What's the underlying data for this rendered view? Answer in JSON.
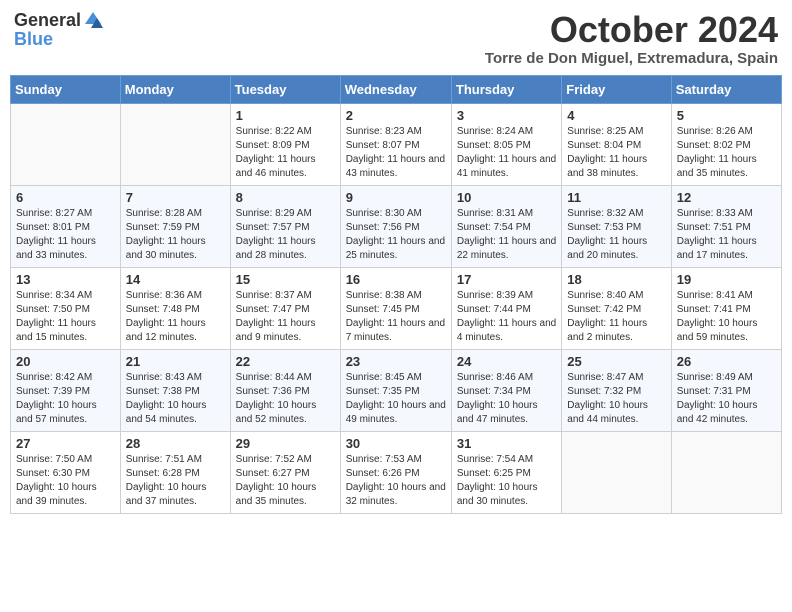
{
  "header": {
    "logo_general": "General",
    "logo_blue": "Blue",
    "month": "October 2024",
    "location": "Torre de Don Miguel, Extremadura, Spain"
  },
  "days_of_week": [
    "Sunday",
    "Monday",
    "Tuesday",
    "Wednesday",
    "Thursday",
    "Friday",
    "Saturday"
  ],
  "weeks": [
    [
      {
        "day": "",
        "sunrise": "",
        "sunset": "",
        "daylight": ""
      },
      {
        "day": "",
        "sunrise": "",
        "sunset": "",
        "daylight": ""
      },
      {
        "day": "1",
        "sunrise": "Sunrise: 8:22 AM",
        "sunset": "Sunset: 8:09 PM",
        "daylight": "Daylight: 11 hours and 46 minutes."
      },
      {
        "day": "2",
        "sunrise": "Sunrise: 8:23 AM",
        "sunset": "Sunset: 8:07 PM",
        "daylight": "Daylight: 11 hours and 43 minutes."
      },
      {
        "day": "3",
        "sunrise": "Sunrise: 8:24 AM",
        "sunset": "Sunset: 8:05 PM",
        "daylight": "Daylight: 11 hours and 41 minutes."
      },
      {
        "day": "4",
        "sunrise": "Sunrise: 8:25 AM",
        "sunset": "Sunset: 8:04 PM",
        "daylight": "Daylight: 11 hours and 38 minutes."
      },
      {
        "day": "5",
        "sunrise": "Sunrise: 8:26 AM",
        "sunset": "Sunset: 8:02 PM",
        "daylight": "Daylight: 11 hours and 35 minutes."
      }
    ],
    [
      {
        "day": "6",
        "sunrise": "Sunrise: 8:27 AM",
        "sunset": "Sunset: 8:01 PM",
        "daylight": "Daylight: 11 hours and 33 minutes."
      },
      {
        "day": "7",
        "sunrise": "Sunrise: 8:28 AM",
        "sunset": "Sunset: 7:59 PM",
        "daylight": "Daylight: 11 hours and 30 minutes."
      },
      {
        "day": "8",
        "sunrise": "Sunrise: 8:29 AM",
        "sunset": "Sunset: 7:57 PM",
        "daylight": "Daylight: 11 hours and 28 minutes."
      },
      {
        "day": "9",
        "sunrise": "Sunrise: 8:30 AM",
        "sunset": "Sunset: 7:56 PM",
        "daylight": "Daylight: 11 hours and 25 minutes."
      },
      {
        "day": "10",
        "sunrise": "Sunrise: 8:31 AM",
        "sunset": "Sunset: 7:54 PM",
        "daylight": "Daylight: 11 hours and 22 minutes."
      },
      {
        "day": "11",
        "sunrise": "Sunrise: 8:32 AM",
        "sunset": "Sunset: 7:53 PM",
        "daylight": "Daylight: 11 hours and 20 minutes."
      },
      {
        "day": "12",
        "sunrise": "Sunrise: 8:33 AM",
        "sunset": "Sunset: 7:51 PM",
        "daylight": "Daylight: 11 hours and 17 minutes."
      }
    ],
    [
      {
        "day": "13",
        "sunrise": "Sunrise: 8:34 AM",
        "sunset": "Sunset: 7:50 PM",
        "daylight": "Daylight: 11 hours and 15 minutes."
      },
      {
        "day": "14",
        "sunrise": "Sunrise: 8:36 AM",
        "sunset": "Sunset: 7:48 PM",
        "daylight": "Daylight: 11 hours and 12 minutes."
      },
      {
        "day": "15",
        "sunrise": "Sunrise: 8:37 AM",
        "sunset": "Sunset: 7:47 PM",
        "daylight": "Daylight: 11 hours and 9 minutes."
      },
      {
        "day": "16",
        "sunrise": "Sunrise: 8:38 AM",
        "sunset": "Sunset: 7:45 PM",
        "daylight": "Daylight: 11 hours and 7 minutes."
      },
      {
        "day": "17",
        "sunrise": "Sunrise: 8:39 AM",
        "sunset": "Sunset: 7:44 PM",
        "daylight": "Daylight: 11 hours and 4 minutes."
      },
      {
        "day": "18",
        "sunrise": "Sunrise: 8:40 AM",
        "sunset": "Sunset: 7:42 PM",
        "daylight": "Daylight: 11 hours and 2 minutes."
      },
      {
        "day": "19",
        "sunrise": "Sunrise: 8:41 AM",
        "sunset": "Sunset: 7:41 PM",
        "daylight": "Daylight: 10 hours and 59 minutes."
      }
    ],
    [
      {
        "day": "20",
        "sunrise": "Sunrise: 8:42 AM",
        "sunset": "Sunset: 7:39 PM",
        "daylight": "Daylight: 10 hours and 57 minutes."
      },
      {
        "day": "21",
        "sunrise": "Sunrise: 8:43 AM",
        "sunset": "Sunset: 7:38 PM",
        "daylight": "Daylight: 10 hours and 54 minutes."
      },
      {
        "day": "22",
        "sunrise": "Sunrise: 8:44 AM",
        "sunset": "Sunset: 7:36 PM",
        "daylight": "Daylight: 10 hours and 52 minutes."
      },
      {
        "day": "23",
        "sunrise": "Sunrise: 8:45 AM",
        "sunset": "Sunset: 7:35 PM",
        "daylight": "Daylight: 10 hours and 49 minutes."
      },
      {
        "day": "24",
        "sunrise": "Sunrise: 8:46 AM",
        "sunset": "Sunset: 7:34 PM",
        "daylight": "Daylight: 10 hours and 47 minutes."
      },
      {
        "day": "25",
        "sunrise": "Sunrise: 8:47 AM",
        "sunset": "Sunset: 7:32 PM",
        "daylight": "Daylight: 10 hours and 44 minutes."
      },
      {
        "day": "26",
        "sunrise": "Sunrise: 8:49 AM",
        "sunset": "Sunset: 7:31 PM",
        "daylight": "Daylight: 10 hours and 42 minutes."
      }
    ],
    [
      {
        "day": "27",
        "sunrise": "Sunrise: 7:50 AM",
        "sunset": "Sunset: 6:30 PM",
        "daylight": "Daylight: 10 hours and 39 minutes."
      },
      {
        "day": "28",
        "sunrise": "Sunrise: 7:51 AM",
        "sunset": "Sunset: 6:28 PM",
        "daylight": "Daylight: 10 hours and 37 minutes."
      },
      {
        "day": "29",
        "sunrise": "Sunrise: 7:52 AM",
        "sunset": "Sunset: 6:27 PM",
        "daylight": "Daylight: 10 hours and 35 minutes."
      },
      {
        "day": "30",
        "sunrise": "Sunrise: 7:53 AM",
        "sunset": "Sunset: 6:26 PM",
        "daylight": "Daylight: 10 hours and 32 minutes."
      },
      {
        "day": "31",
        "sunrise": "Sunrise: 7:54 AM",
        "sunset": "Sunset: 6:25 PM",
        "daylight": "Daylight: 10 hours and 30 minutes."
      },
      {
        "day": "",
        "sunrise": "",
        "sunset": "",
        "daylight": ""
      },
      {
        "day": "",
        "sunrise": "",
        "sunset": "",
        "daylight": ""
      }
    ]
  ]
}
